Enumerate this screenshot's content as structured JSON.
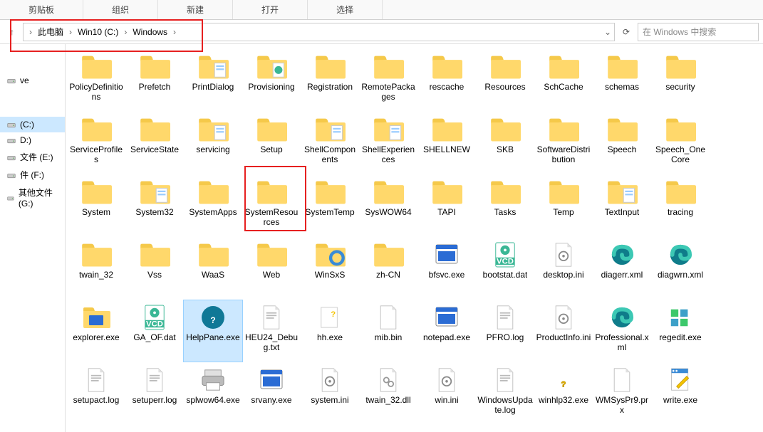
{
  "ribbon": {
    "groups": [
      "剪贴板",
      "组织",
      "新建",
      "打开",
      "选择"
    ]
  },
  "breadcrumb": {
    "arrow_up": "↑",
    "items": [
      "此电脑",
      "Win10 (C:)",
      "Windows"
    ],
    "refresh": "⟳"
  },
  "search": {
    "placeholder": "在 Windows 中搜索"
  },
  "sidebar": {
    "items": [
      {
        "label": "",
        "type": "blank"
      },
      {
        "label": "",
        "type": "blank"
      },
      {
        "label": "",
        "type": "blank"
      },
      {
        "label": "",
        "type": "blank"
      },
      {
        "label": "ve",
        "type": "drive"
      },
      {
        "label": "",
        "type": "blank"
      },
      {
        "label": "",
        "type": "blank"
      },
      {
        "label": "",
        "type": "blank"
      },
      {
        "label": "",
        "type": "blank"
      },
      {
        "label": "",
        "type": "blank"
      },
      {
        "label": " (C:)",
        "type": "drive",
        "active": true
      },
      {
        "label": "D:)",
        "type": "drive"
      },
      {
        "label": "文件 (E:)",
        "type": "drive"
      },
      {
        "label": "件 (F:)",
        "type": "drive"
      },
      {
        "label": "其他文件 (G:)",
        "type": "drive"
      }
    ]
  },
  "files": [
    {
      "name": "PolicyDefinitions",
      "type": "folder"
    },
    {
      "name": "Prefetch",
      "type": "folder"
    },
    {
      "name": "PrintDialog",
      "type": "folder-doc"
    },
    {
      "name": "Provisioning",
      "type": "folder-green"
    },
    {
      "name": "Registration",
      "type": "folder"
    },
    {
      "name": "RemotePackages",
      "type": "folder"
    },
    {
      "name": "rescache",
      "type": "folder"
    },
    {
      "name": "Resources",
      "type": "folder"
    },
    {
      "name": "SchCache",
      "type": "folder"
    },
    {
      "name": "schemas",
      "type": "folder"
    },
    {
      "name": "security",
      "type": "folder"
    },
    {
      "name": "ServiceProfiles",
      "type": "folder"
    },
    {
      "name": "ServiceState",
      "type": "folder"
    },
    {
      "name": "servicing",
      "type": "folder-doc"
    },
    {
      "name": "Setup",
      "type": "folder"
    },
    {
      "name": "ShellComponents",
      "type": "folder-doc"
    },
    {
      "name": "ShellExperiences",
      "type": "folder-doc"
    },
    {
      "name": "SHELLNEW",
      "type": "folder"
    },
    {
      "name": "SKB",
      "type": "folder"
    },
    {
      "name": "SoftwareDistribution",
      "type": "folder"
    },
    {
      "name": "Speech",
      "type": "folder"
    },
    {
      "name": "Speech_OneCore",
      "type": "folder"
    },
    {
      "name": "System",
      "type": "folder"
    },
    {
      "name": "System32",
      "type": "folder-doc"
    },
    {
      "name": "SystemApps",
      "type": "folder"
    },
    {
      "name": "SystemResources",
      "type": "folder"
    },
    {
      "name": "SystemTemp",
      "type": "folder"
    },
    {
      "name": "SysWOW64",
      "type": "folder"
    },
    {
      "name": "TAPI",
      "type": "folder"
    },
    {
      "name": "Tasks",
      "type": "folder"
    },
    {
      "name": "Temp",
      "type": "folder"
    },
    {
      "name": "TextInput",
      "type": "folder-doc"
    },
    {
      "name": "tracing",
      "type": "folder"
    },
    {
      "name": "twain_32",
      "type": "folder"
    },
    {
      "name": "Vss",
      "type": "folder"
    },
    {
      "name": "WaaS",
      "type": "folder"
    },
    {
      "name": "Web",
      "type": "folder"
    },
    {
      "name": "WinSxS",
      "type": "folder-bluecircle"
    },
    {
      "name": "zh-CN",
      "type": "folder"
    },
    {
      "name": "bfsvc.exe",
      "type": "exe-blue"
    },
    {
      "name": "bootstat.dat",
      "type": "vcd"
    },
    {
      "name": "desktop.ini",
      "type": "ini"
    },
    {
      "name": "diagerr.xml",
      "type": "edge"
    },
    {
      "name": "diagwrn.xml",
      "type": "edge"
    },
    {
      "name": "explorer.exe",
      "type": "explorer"
    },
    {
      "name": "GA_OF.dat",
      "type": "vcd"
    },
    {
      "name": "HelpPane.exe",
      "type": "help",
      "selected": true
    },
    {
      "name": "HEU24_Debug.txt",
      "type": "txt"
    },
    {
      "name": "hh.exe",
      "type": "hh"
    },
    {
      "name": "mib.bin",
      "type": "file"
    },
    {
      "name": "notepad.exe",
      "type": "exe-blue"
    },
    {
      "name": "PFRO.log",
      "type": "txt"
    },
    {
      "name": "ProductInfo.ini",
      "type": "ini"
    },
    {
      "name": "Professional.xml",
      "type": "edge"
    },
    {
      "name": "regedit.exe",
      "type": "regedit"
    },
    {
      "name": "setupact.log",
      "type": "txt"
    },
    {
      "name": "setuperr.log",
      "type": "txt"
    },
    {
      "name": "splwow64.exe",
      "type": "printer"
    },
    {
      "name": "srvany.exe",
      "type": "exe-blue"
    },
    {
      "name": "system.ini",
      "type": "ini"
    },
    {
      "name": "twain_32.dll",
      "type": "dll"
    },
    {
      "name": "win.ini",
      "type": "ini"
    },
    {
      "name": "WindowsUpdate.log",
      "type": "txt"
    },
    {
      "name": "winhlp32.exe",
      "type": "winhlp"
    },
    {
      "name": "WMSysPr9.prx",
      "type": "file"
    },
    {
      "name": "write.exe",
      "type": "write"
    }
  ]
}
